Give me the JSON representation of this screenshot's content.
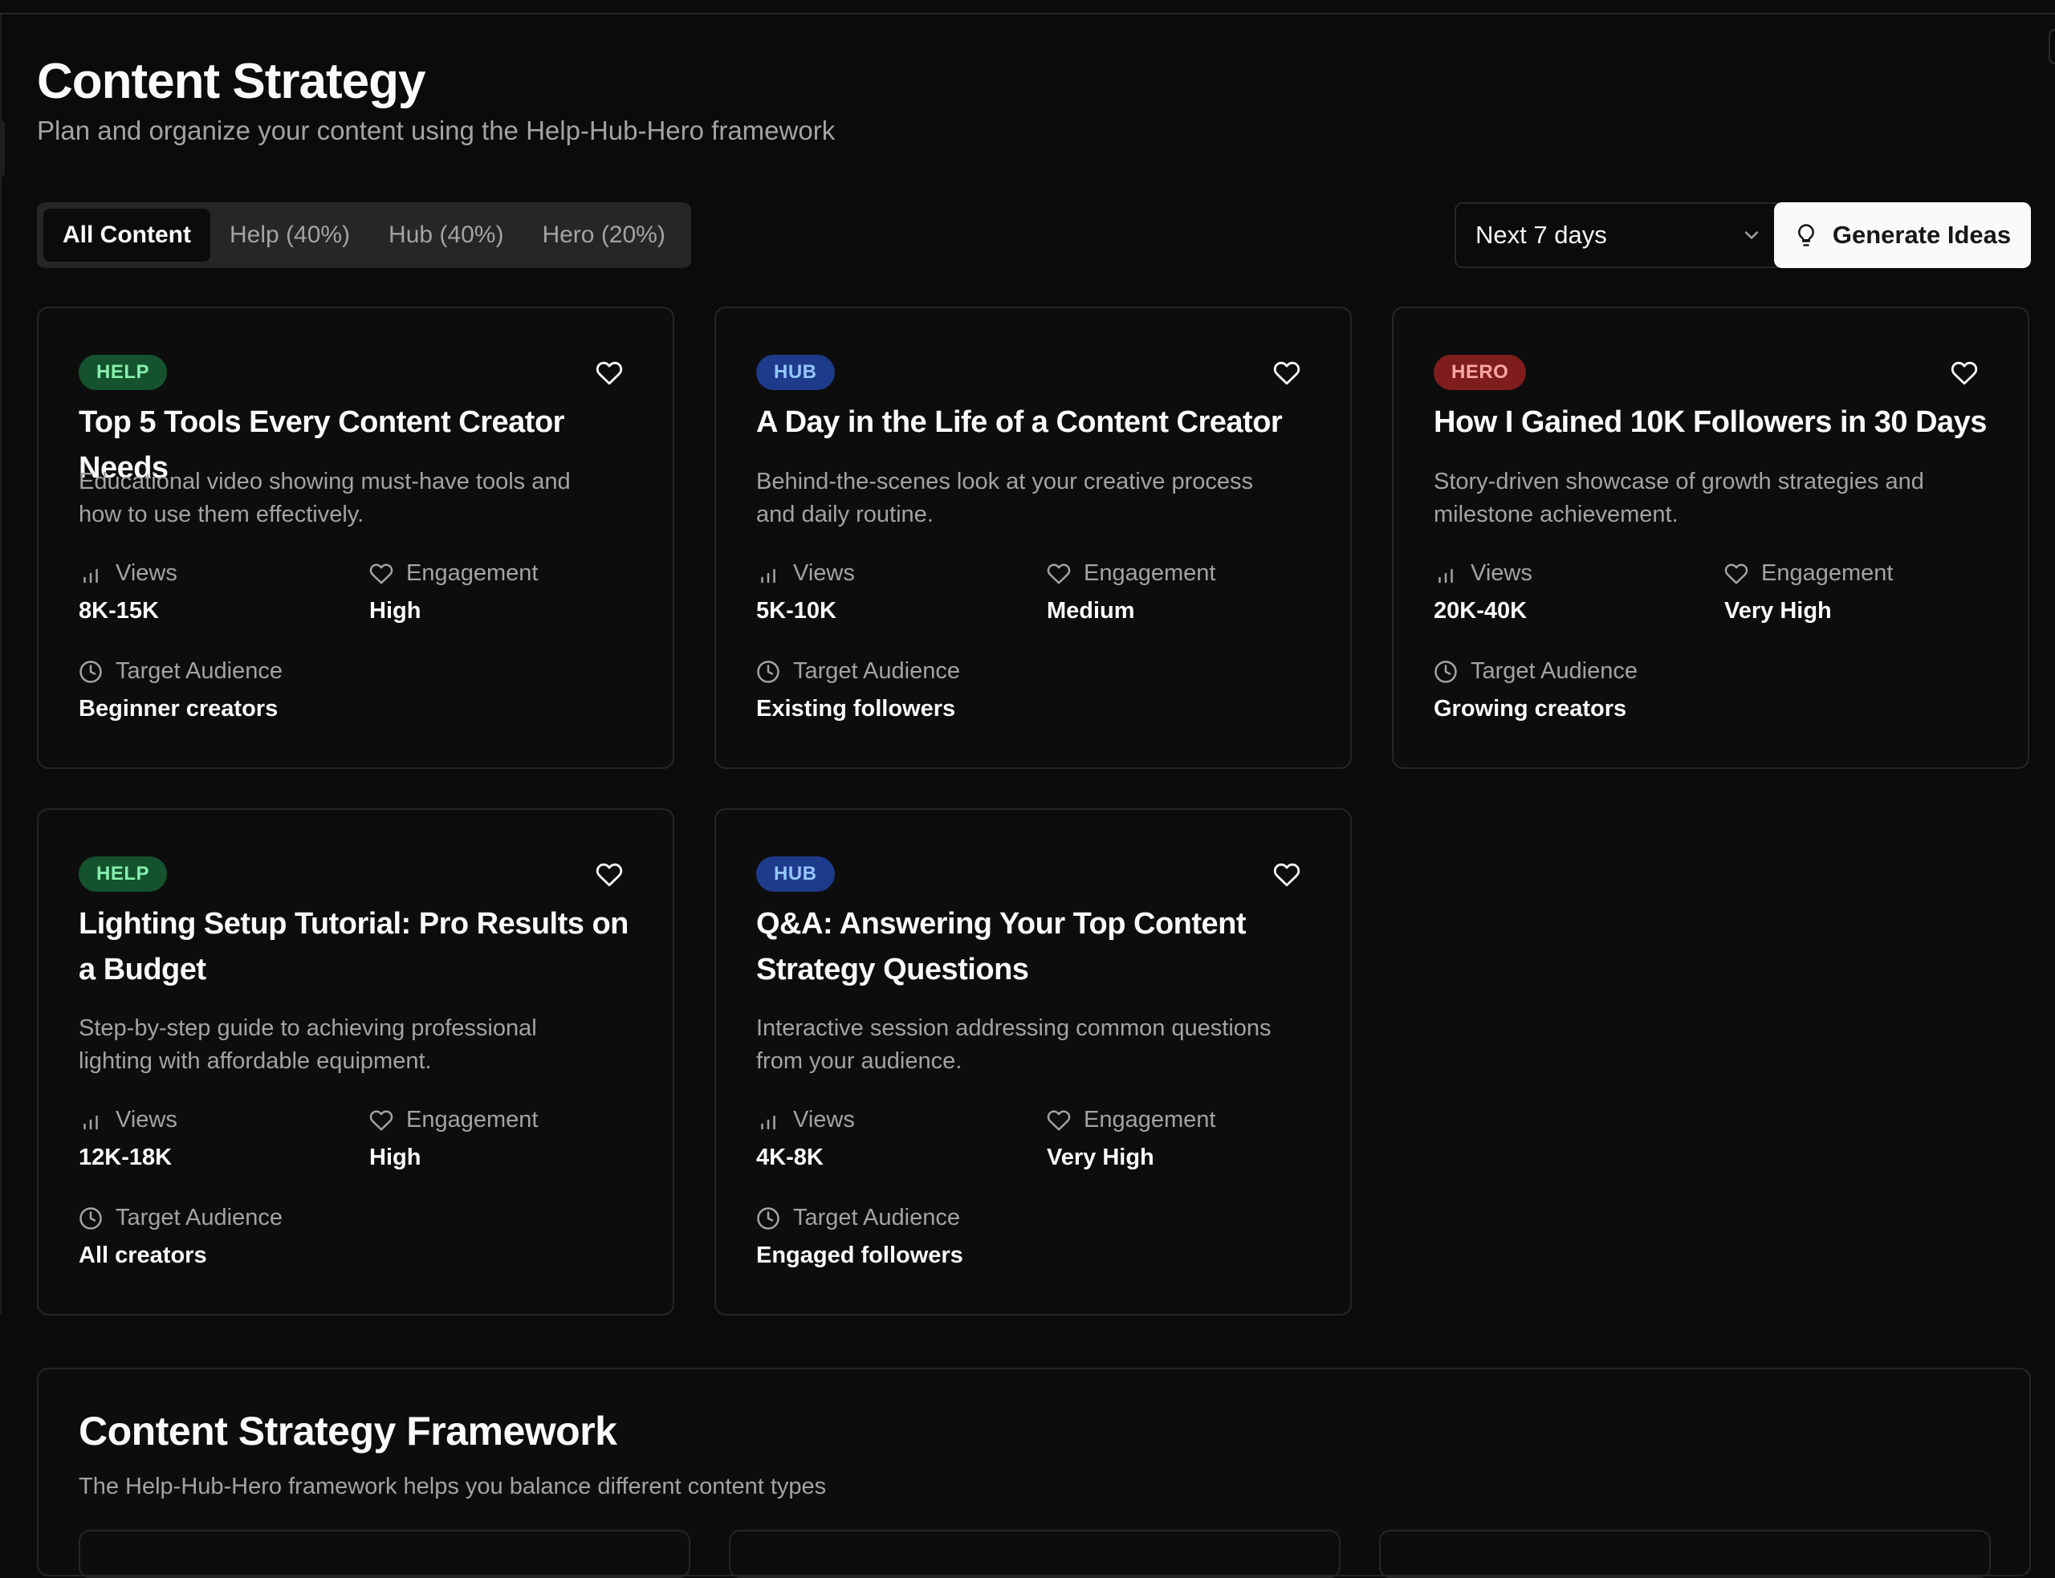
{
  "header": {
    "title": "Content Strategy",
    "subtitle": "Plan and organize your content using the Help-Hub-Hero framework"
  },
  "tabs": [
    {
      "label": "All Content",
      "active": true
    },
    {
      "label": "Help (40%)"
    },
    {
      "label": "Hub (40%)"
    },
    {
      "label": "Hero (20%)"
    }
  ],
  "range_select": {
    "value": "Next 7 days"
  },
  "generate_button": {
    "label": "Generate Ideas"
  },
  "metric_labels": {
    "views": "Views",
    "engagement": "Engagement",
    "audience": "Target Audience"
  },
  "cards": [
    {
      "badge": "HELP",
      "type": "help",
      "title": "Top 5 Tools Every Content Creator Needs",
      "description": "Educational video showing must-have tools and how to use them effectively.",
      "views": "8K-15K",
      "engagement": "High",
      "audience": "Beginner creators"
    },
    {
      "badge": "HUB",
      "type": "hub",
      "title": "A Day in the Life of a Content Creator",
      "description": "Behind-the-scenes look at your creative process and daily routine.",
      "views": "5K-10K",
      "engagement": "Medium",
      "audience": "Existing followers"
    },
    {
      "badge": "HERO",
      "type": "hero",
      "title": "How I Gained 10K Followers in 30 Days",
      "description": "Story-driven showcase of growth strategies and milestone achievement.",
      "views": "20K-40K",
      "engagement": "Very High",
      "audience": "Growing creators"
    },
    {
      "badge": "HELP",
      "type": "help",
      "title": "Lighting Setup Tutorial: Pro Results on a Budget",
      "description": "Step-by-step guide to achieving professional lighting with affordable equipment.",
      "views": "12K-18K",
      "engagement": "High",
      "audience": "All creators"
    },
    {
      "badge": "HUB",
      "type": "hub",
      "title": "Q&A: Answering Your Top Content Strategy Questions",
      "description": "Interactive session addressing common questions from your audience.",
      "views": "4K-8K",
      "engagement": "Very High",
      "audience": "Engaged followers"
    }
  ],
  "framework": {
    "title": "Content Strategy Framework",
    "subtitle": "The Help-Hub-Hero framework helps you balance different content types"
  },
  "colors": {
    "background": "#0b0b0b",
    "help_badge": "#14532d",
    "hub_badge": "#1e3a8a",
    "hero_badge": "#7f1d1d"
  }
}
